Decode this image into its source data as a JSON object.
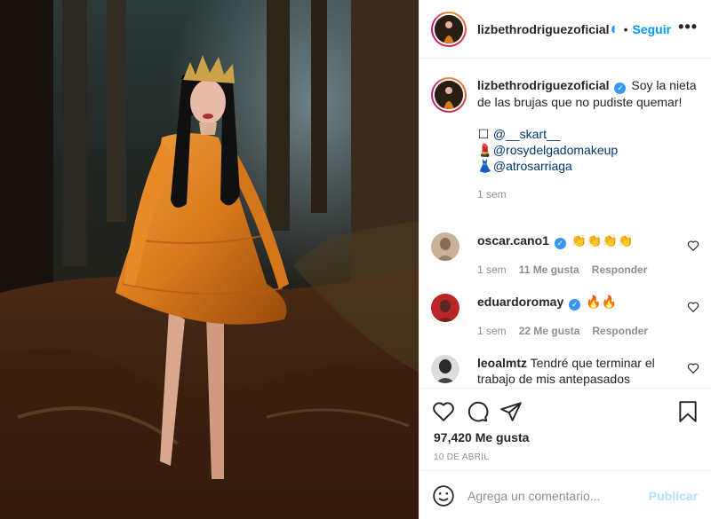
{
  "header": {
    "username": "lizbethrodriguezoficial",
    "separator": "•",
    "follow_label": "Seguir",
    "more_label": "•••"
  },
  "caption": {
    "username": "lizbethrodriguezoficial",
    "verified_glyph": "✓",
    "text": "Soy la nieta de las brujas que no pudiste quemar!",
    "credits": [
      {
        "emoji": "☐",
        "handle": "@__skart__"
      },
      {
        "emoji": "💄",
        "handle": "@rosydelgadomakeup"
      },
      {
        "emoji": "👗",
        "handle": "@atrosarriaga"
      }
    ],
    "time": "1 sem"
  },
  "comments": [
    {
      "username": "oscar.cano1",
      "verified": "✓",
      "text": "👏👏👏👏",
      "time": "1 sem",
      "likes": "11 Me gusta",
      "reply": "Responder"
    },
    {
      "username": "eduardoromay",
      "verified": "✓",
      "text": "🔥🔥",
      "time": "1 sem",
      "likes": "22 Me gusta",
      "reply": "Responder"
    },
    {
      "username": "leoalmtz",
      "text": "Tendré que terminar el trabajo de mis antepasados"
    }
  ],
  "actions": {
    "likes_count": "97,420 Me gusta",
    "date": "10 DE ABRIL"
  },
  "add_comment": {
    "placeholder": "Agrega un comentario...",
    "publish_label": "Publicar"
  },
  "colors": {
    "accent": "#0095f6",
    "verified": "#3897f0",
    "muted": "#8e8e8e",
    "publish_disabled": "#b2dffc",
    "dress": "#d97a1c"
  },
  "icons": [
    "heart-icon",
    "comment-icon",
    "share-icon",
    "bookmark-icon",
    "smile-icon",
    "more-icon",
    "verified-icon"
  ]
}
